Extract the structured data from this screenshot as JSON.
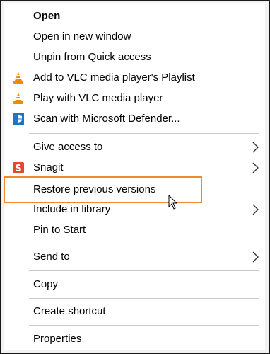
{
  "menu": {
    "open": "Open",
    "open_new_window": "Open in new window",
    "unpin_quick_access": "Unpin from Quick access",
    "vlc_playlist": "Add to VLC media player's Playlist",
    "vlc_play": "Play with VLC media player",
    "defender_scan": "Scan with Microsoft Defender...",
    "give_access": "Give access to",
    "snagit": "Snagit",
    "restore_versions": "Restore previous versions",
    "include_library": "Include in library",
    "pin_start": "Pin to Start",
    "send_to": "Send to",
    "copy": "Copy",
    "create_shortcut": "Create shortcut",
    "properties": "Properties"
  },
  "colors": {
    "highlight_border": "#ef8a2c",
    "vlc_orange": "#f08a00",
    "defender_blue": "#1f73c6",
    "snagit_red": "#e14b2c"
  },
  "icons": {
    "vlc": "vlc-cone-icon",
    "defender": "defender-shield-icon",
    "snagit": "snagit-s-icon",
    "submenu": "chevron-right-icon",
    "cursor": "mouse-pointer-icon"
  }
}
